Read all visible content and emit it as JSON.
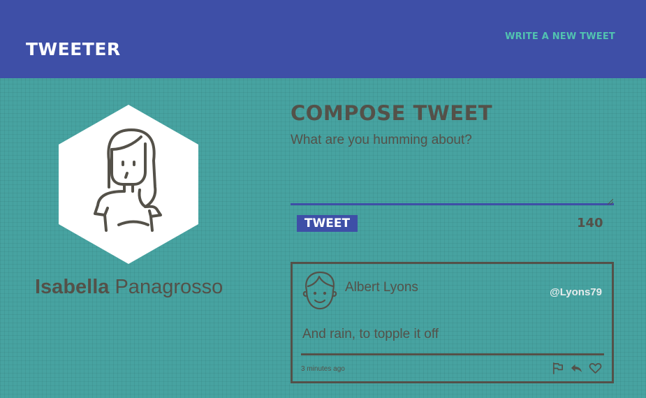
{
  "navbar": {
    "brand": "TWEETER",
    "write_link": "WRITE A NEW TWEET",
    "background": "#3e4fa7",
    "link_color": "#52c3b0"
  },
  "profile": {
    "first_name": "Isabella",
    "last_name": "Panagrosso",
    "avatar_icon": "woman-avatar-icon"
  },
  "compose": {
    "title": "COMPOSE TWEET",
    "placeholder": "What are you humming about?",
    "value": "",
    "button_label": "TWEET",
    "counter": "140"
  },
  "tweets": [
    {
      "author": "Albert Lyons",
      "handle": "@Lyons79",
      "body": "And rain, to topple it off",
      "time": "3 minutes ago",
      "avatar_icon": "man-avatar-icon",
      "actions": [
        "flag-icon",
        "retweet-icon",
        "heart-icon"
      ]
    }
  ],
  "colors": {
    "page_background": "#47a3a1",
    "text": "#545149",
    "handle": "#e6ecec"
  }
}
